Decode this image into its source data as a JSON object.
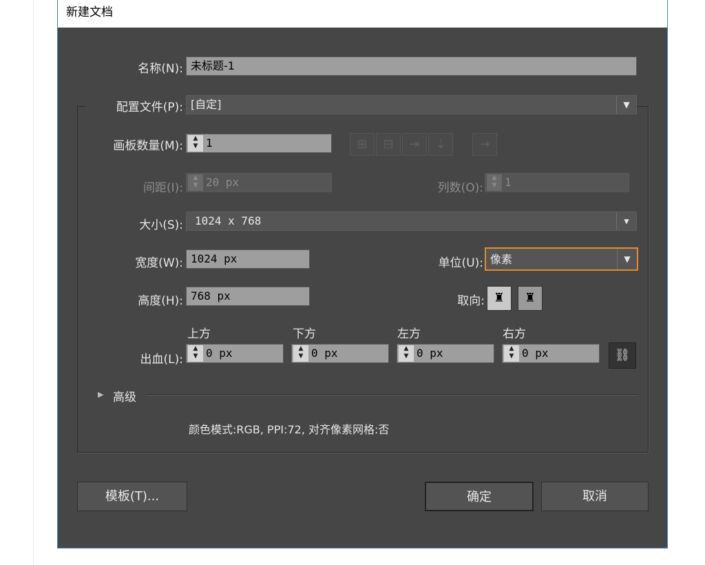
{
  "window": {
    "title": "新建文档"
  },
  "name": {
    "label": "名称(N):",
    "value": "未标题-1"
  },
  "profile": {
    "label": "配置文件(P):",
    "value": "[自定]"
  },
  "artboards": {
    "label": "画板数量(M):",
    "value": "1",
    "spacing_label": "间距(I):",
    "spacing_value": "20 px",
    "columns_label": "列数(O):",
    "columns_value": "1",
    "layout_icons": [
      "grid-by-row-icon",
      "grid-by-column-icon",
      "arrange-by-row-icon",
      "arrange-by-column-icon",
      "right-to-left-icon"
    ]
  },
  "size": {
    "label": "大小(S):",
    "value": "1024 x 768"
  },
  "width": {
    "label": "宽度(W):",
    "value": "1024 px"
  },
  "height": {
    "label": "高度(H):",
    "value": "768 px"
  },
  "units": {
    "label": "单位(U):",
    "value": "像素"
  },
  "orientation": {
    "label": "取向:",
    "icons": [
      "portrait-icon",
      "landscape-icon"
    ]
  },
  "bleed": {
    "label": "出血(L):",
    "top_label": "上方",
    "top_value": "0 px",
    "bottom_label": "下方",
    "bottom_value": "0 px",
    "left_label": "左方",
    "left_value": "0 px",
    "right_label": "右方",
    "right_value": "0 px"
  },
  "advanced": {
    "label": "高级"
  },
  "summary": "颜色模式:RGB, PPI:72, 对齐像素网格:否",
  "buttons": {
    "templates": "模板(T)...",
    "ok": "确定",
    "cancel": "取消"
  },
  "colors": {
    "dialog_bg": "#464646",
    "field_bg": "#9e9e9e",
    "focus_border": "#e8892b",
    "title_border": "#3b7fc4"
  }
}
